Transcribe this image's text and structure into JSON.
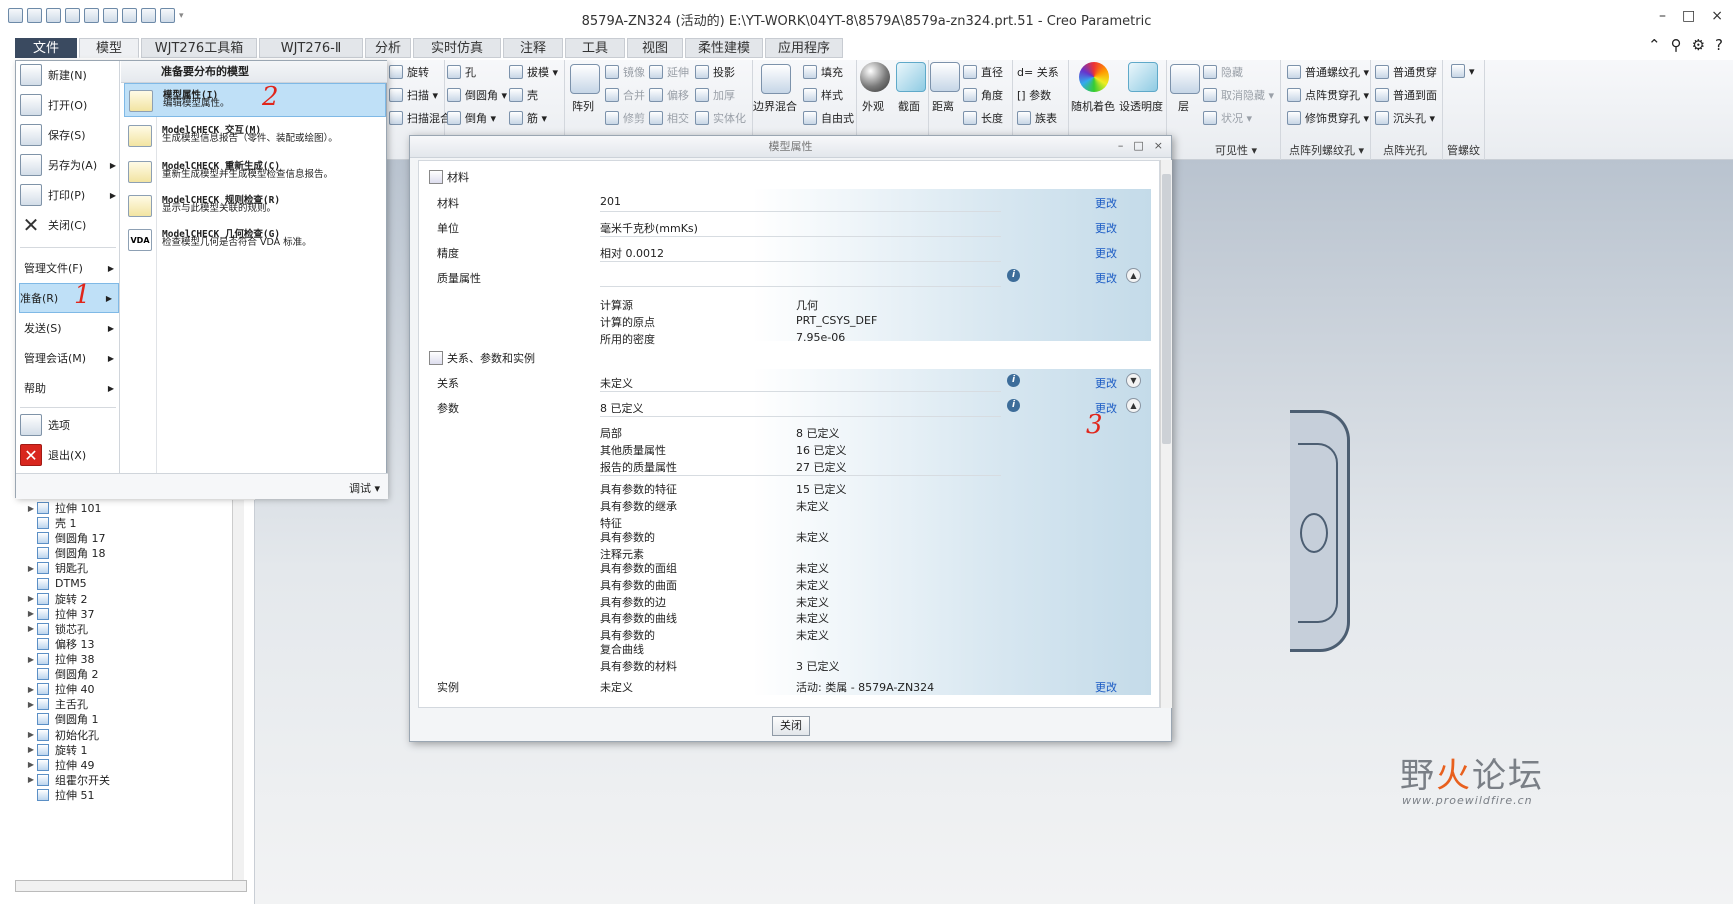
{
  "window": {
    "title": "8579A-ZN324 (活动的) E:\\YT-WORK\\04YT-8\\8579A\\8579a-zn324.prt.51 - Creo Parametric",
    "minimize": "–",
    "restore": "□",
    "close": "×"
  },
  "tabs": [
    "文件",
    "模型",
    "WJT276工具箱",
    "WJT276-Ⅱ",
    "分析",
    "实时仿真",
    "注释",
    "工具",
    "视图",
    "柔性建模",
    "应用程序"
  ],
  "ribbon": {
    "col1": [
      "旋转",
      "扫描 ▾",
      "扫描混合"
    ],
    "col2": [
      "孔",
      "倒圆角 ▾",
      "倒角 ▾"
    ],
    "col3": [
      "拔模 ▾",
      "壳",
      "筋 ▾"
    ],
    "array": "阵列",
    "edit1": [
      "镜像",
      "合并",
      "修剪"
    ],
    "edit2": [
      "延伸",
      "偏移",
      "相交"
    ],
    "edit3": [
      "投影",
      "加厚",
      "实体化"
    ],
    "boundary": "边界混合",
    "surface": [
      "填充",
      "样式",
      "自由式"
    ],
    "appearance": "外观",
    "section": "截面",
    "distance": "距离",
    "measure": [
      "直径",
      "角度",
      "长度"
    ],
    "relations": [
      "d= 关系",
      "[] 参数",
      "族表"
    ],
    "random_color": "随机着色",
    "transparency": "设透明度",
    "layer": "层",
    "hide": [
      "隐藏",
      "取消隐藏 ▾",
      "状况 ▾"
    ],
    "thread": [
      "普通螺纹孔 ▾",
      "点阵贯穿孔 ▾",
      "修饰贯穿孔 ▾"
    ],
    "through": [
      "普通贯穿",
      "普通到面",
      "沉头孔 ▾"
    ],
    "group_labels": [
      "可见性 ▾",
      "点阵列螺纹孔 ▾",
      "点阵光孔",
      "管螺纹"
    ]
  },
  "file_menu": {
    "items": [
      {
        "label": "新建(N)"
      },
      {
        "label": "打开(O)"
      },
      {
        "label": "保存(S)"
      },
      {
        "label": "另存为(A)"
      },
      {
        "label": "打印(P)"
      },
      {
        "label": "关闭(C)"
      }
    ],
    "text_items": [
      "管理文件(F)",
      "准备(R)",
      "发送(S)",
      "管理会话(M)",
      "帮助"
    ],
    "options": "选项",
    "exit": "退出(X)",
    "submenu_title": "准备要分布的模型",
    "submenu": [
      {
        "title": "模型属性(I)",
        "desc": "编辑模型属性。"
      },
      {
        "title": "ModelCHECK 交互(M)",
        "desc": "生成模型信息报告（零件、装配或绘图）。"
      },
      {
        "title": "ModelCHECK 重新生成(C)",
        "desc": "重新生成模型并生成模型检查信息报告。"
      },
      {
        "title": "ModelCHECK 规则检查(R)",
        "desc": "显示与此模型关联的规则。"
      },
      {
        "title": "ModelCHECK 几何检查(G)",
        "desc": "检查模型几何是否符合 VDA 标准。"
      }
    ],
    "vda_icon": "VDA",
    "debug": "调试 ▾"
  },
  "tree": [
    {
      "label": "拉伸 101",
      "arrow": true
    },
    {
      "label": "壳 1",
      "arrow": false
    },
    {
      "label": "倒圆角 17",
      "arrow": false
    },
    {
      "label": "倒圆角 18",
      "arrow": false
    },
    {
      "label": "钥匙孔",
      "arrow": true
    },
    {
      "label": "DTM5",
      "arrow": false
    },
    {
      "label": "旋转 2",
      "arrow": true
    },
    {
      "label": "拉伸 37",
      "arrow": true
    },
    {
      "label": "锁芯孔",
      "arrow": true
    },
    {
      "label": "偏移 13",
      "arrow": false
    },
    {
      "label": "拉伸 38",
      "arrow": true
    },
    {
      "label": "倒圆角 2",
      "arrow": false
    },
    {
      "label": "拉伸 40",
      "arrow": true
    },
    {
      "label": "主舌孔",
      "arrow": true
    },
    {
      "label": "倒圆角 1",
      "arrow": false
    },
    {
      "label": "初始化孔",
      "arrow": true
    },
    {
      "label": "旋转 1",
      "arrow": true
    },
    {
      "label": "拉伸 49",
      "arrow": true
    },
    {
      "label": "组霍尔开关",
      "arrow": true
    },
    {
      "label": "拉伸 51",
      "arrow": false
    }
  ],
  "dialog": {
    "title": "模型属性",
    "controls": [
      "–",
      "□",
      "×"
    ],
    "section_material": "材料",
    "section_relations": "关系、参数和实例",
    "change": "更改",
    "info": "i",
    "toggle_up": "▲",
    "toggle_down": "▼",
    "material_rows": [
      {
        "label": "材料",
        "value": "201"
      },
      {
        "label": "单位",
        "value": "毫米千克秒(mmKs)"
      },
      {
        "label": "精度",
        "value": "相对 0.0012"
      },
      {
        "label": "质量属性",
        "value": ""
      }
    ],
    "mass_sub": [
      {
        "label": "计算源",
        "value": "几何"
      },
      {
        "label": "计算的原点",
        "value": "PRT_CSYS_DEF"
      },
      {
        "label": "所用的密度",
        "value": "7.95e-06"
      }
    ],
    "rel_rows": [
      {
        "label": "关系",
        "value": "未定义"
      },
      {
        "label": "参数",
        "value": "8 已定义"
      }
    ],
    "param_sub": [
      {
        "label": "局部",
        "value": "8 已定义"
      },
      {
        "label": "其他质量属性",
        "value": "16 已定义"
      },
      {
        "label": "报告的质量属性",
        "value": "27 已定义"
      },
      {
        "label": "具有参数的特征",
        "value": "15 已定义"
      },
      {
        "label": "具有参数的继承",
        "value": "未定义"
      },
      {
        "label": "特征",
        "value": ""
      },
      {
        "label": "具有参数的",
        "value": "未定义"
      },
      {
        "label": "注释元素",
        "value": ""
      },
      {
        "label": "具有参数的面组",
        "value": "未定义"
      },
      {
        "label": "具有参数的曲面",
        "value": "未定义"
      },
      {
        "label": "具有参数的边",
        "value": "未定义"
      },
      {
        "label": "具有参数的曲线",
        "value": "未定义"
      },
      {
        "label": "具有参数的",
        "value": "未定义"
      },
      {
        "label": "复合曲线",
        "value": ""
      },
      {
        "label": "具有参数的材料",
        "value": "3 已定义"
      }
    ],
    "instance": {
      "label": "实例",
      "value": "未定义",
      "extra": "活动: 类属 - 8579A-ZN324"
    },
    "close": "关闭"
  },
  "annotations": [
    "1",
    "2",
    "3"
  ],
  "watermark": {
    "main_a": "野",
    "main_fire": "火",
    "main_b": "论坛",
    "url": "www.proewildfire.cn"
  },
  "colors": {
    "file_tab": "#3a4a60",
    "highlight": "#bfe0f7",
    "link": "#1a5bc4",
    "annotation": "#e0261b"
  }
}
